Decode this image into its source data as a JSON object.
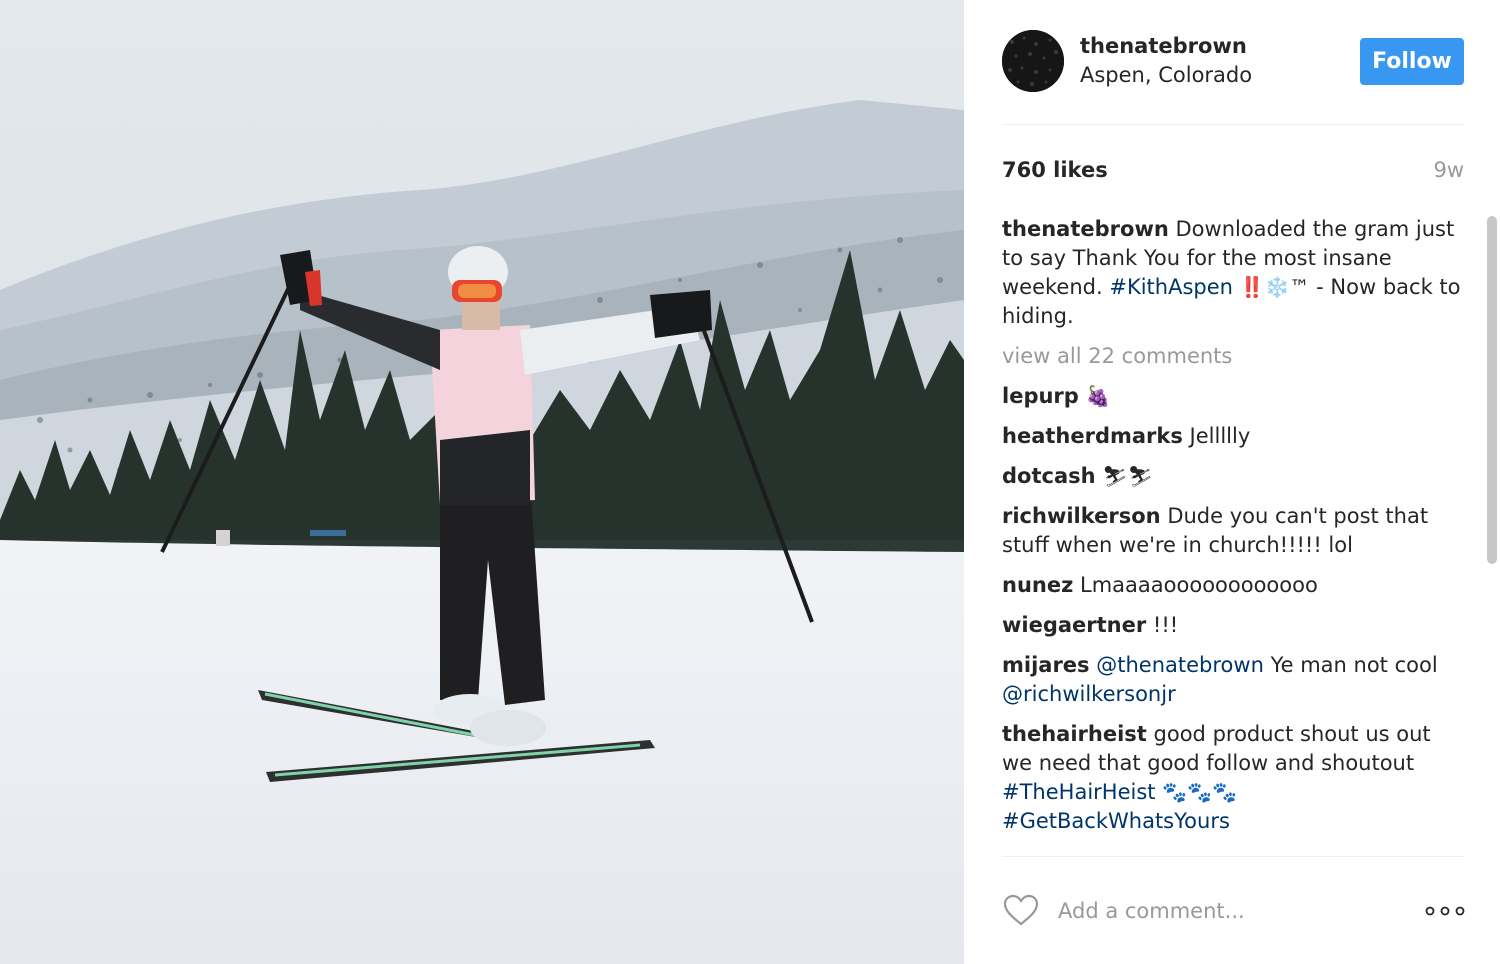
{
  "post": {
    "username": "thenatebrown",
    "location": "Aspen, Colorado",
    "follow_label": "Follow",
    "likes": "760 likes",
    "time": "9w",
    "caption": {
      "user": "thenatebrown",
      "text_1": "Downloaded the gram just to say Thank You for the most insane weekend.",
      "hashtag": "#KithAspen",
      "emoji": "‼️❄️™",
      "text_2": "- Now back to hiding."
    },
    "view_all_comments": "view all 22 comments",
    "comment_placeholder": "Add a comment..."
  },
  "comments": [
    {
      "user": "lepurp",
      "text": "🍇"
    },
    {
      "user": "heatherdmarks",
      "text": "Jellllly"
    },
    {
      "user": "dotcash",
      "text": "⛷⛷"
    },
    {
      "user": "richwilkerson",
      "text": "Dude you can't post that stuff when we're in church!!!!! lol"
    },
    {
      "user": "nunez",
      "text": "Lmaaaaoooooooooooo"
    },
    {
      "user": "wiegaertner",
      "text": "!!!"
    },
    {
      "user": "mijares",
      "mention_1": "@thenatebrown",
      "text": "Ye man not cool",
      "mention_2": "@richwilkersonjr"
    },
    {
      "user": "thehairheist",
      "text": "good product shout us out we need that good follow and shoutout",
      "hashtag_1": "#TheHairHeist",
      "emoji": "🐾🐾🐾",
      "hashtag_2": "#GetBackWhatsYours"
    }
  ],
  "colors": {
    "follow_button": "#3897f0",
    "hashtag": "#003569",
    "muted": "#999999"
  },
  "icons": {
    "like": "heart-icon",
    "more": "more-options-icon"
  }
}
